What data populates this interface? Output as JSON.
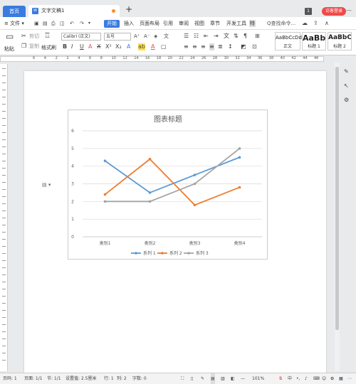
{
  "titlebar": {
    "home_tab": "首页",
    "doc_tab": "文字文稿1",
    "new_tab": "+",
    "badge": "1",
    "user_button": "访客登录",
    "window_controls": "—"
  },
  "menu": {
    "file": "≡ 文件 ▾",
    "items": [
      "开始",
      "插入",
      "页面布局",
      "引用",
      "审阅",
      "视图",
      "章节",
      "开发工具"
    ],
    "special": "特",
    "search": "Q查找命令..."
  },
  "ribbon": {
    "paste": "粘贴",
    "cut": "剪切",
    "copy": "复制",
    "format_painter": "格式刷",
    "font_name": "Calibri (正文)",
    "font_size": "五号",
    "styles": [
      {
        "preview": "AaBbCcDd",
        "label": "正文"
      },
      {
        "preview": "AaBb",
        "label": "标题 1"
      },
      {
        "preview": "AaBbC",
        "label": "标题 2"
      }
    ]
  },
  "ruler": {
    "numbers": [
      "6",
      "4",
      "2",
      "2",
      "4",
      "6",
      "8",
      "10",
      "12",
      "14",
      "16",
      "18",
      "20",
      "22",
      "24",
      "26",
      "28",
      "30",
      "32",
      "34",
      "36",
      "38",
      "40",
      "42",
      "44",
      "46"
    ]
  },
  "status": {
    "page": "页码: 1",
    "pages": "页面: 1/1",
    "section": "节: 1/1",
    "setting": "设置值: 2.5厘米",
    "row": "行: 1",
    "col": "列: 2",
    "words": "字数: 0",
    "zoom": "101%",
    "minus": "—"
  },
  "chart_data": {
    "type": "line",
    "title": "图表标题",
    "categories": [
      "类别1",
      "类别2",
      "类别3",
      "类别4"
    ],
    "ylim": [
      0,
      6
    ],
    "yticks": [
      0,
      1,
      2,
      3,
      4,
      5,
      6
    ],
    "grid": true,
    "legend_position": "bottom",
    "series": [
      {
        "name": "系列 1",
        "color": "#5b9bd5",
        "values": [
          4.3,
          2.5,
          3.5,
          4.5
        ]
      },
      {
        "name": "系列 2",
        "color": "#ed7d31",
        "values": [
          2.4,
          4.4,
          1.8,
          2.8
        ]
      },
      {
        "name": "系列 3",
        "color": "#a5a5a5",
        "values": [
          2,
          2,
          3,
          5
        ]
      }
    ]
  }
}
